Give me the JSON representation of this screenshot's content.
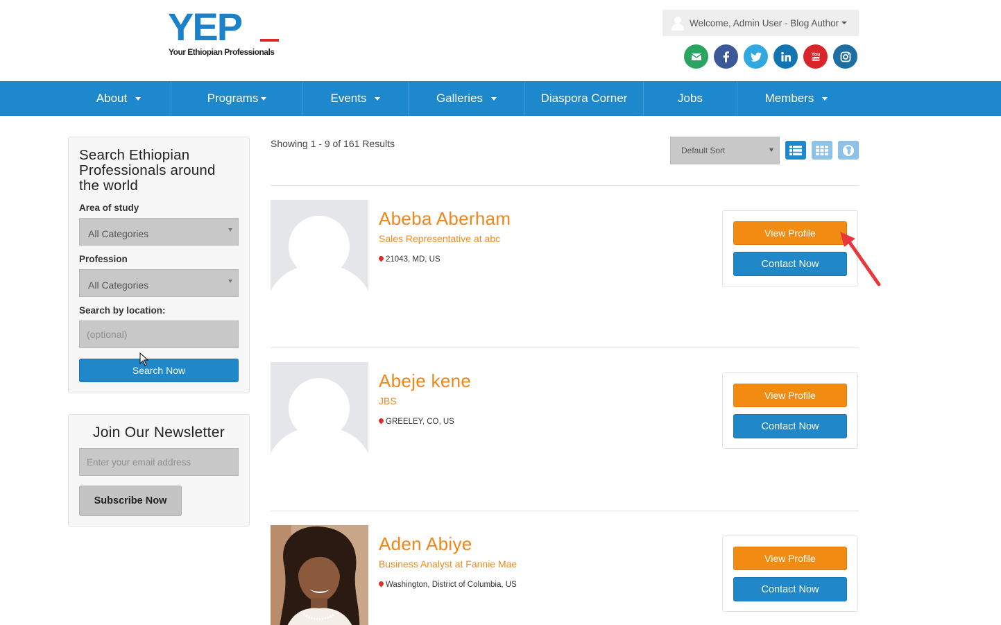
{
  "header": {
    "logo_text": "YEP",
    "logo_tagline": "Your Ethiopian Professionals",
    "welcome_text": "Welcome, Admin User - Blog Author",
    "socials": [
      {
        "name": "email",
        "color": "#2ba462"
      },
      {
        "name": "facebook",
        "color": "#3b5998"
      },
      {
        "name": "twitter",
        "color": "#31a8e0"
      },
      {
        "name": "linkedin",
        "color": "#1275b1"
      },
      {
        "name": "youtube",
        "color": "#d9252a"
      },
      {
        "name": "instagram",
        "color": "#1b6fa3"
      }
    ]
  },
  "nav": {
    "items": [
      {
        "label": "About",
        "has_dropdown": true
      },
      {
        "label": "Programs",
        "has_dropdown": true
      },
      {
        "label": "Events",
        "has_dropdown": true
      },
      {
        "label": "Galleries",
        "has_dropdown": true
      },
      {
        "label": "Diaspora Corner",
        "has_dropdown": false
      },
      {
        "label": "Jobs",
        "has_dropdown": false
      },
      {
        "label": "Members",
        "has_dropdown": true
      }
    ]
  },
  "sidebar": {
    "search": {
      "title": "Search Ethiopian Professionals around the world",
      "area_label": "Area of study",
      "area_value": "All Categories",
      "profession_label": "Profession",
      "profession_value": "All Categories",
      "location_label": "Search by location:",
      "location_placeholder": "(optional)",
      "button_label": "Search Now"
    },
    "newsletter": {
      "title": "Join Our Newsletter",
      "email_placeholder": "Enter your email address",
      "button_label": "Subscribe Now"
    }
  },
  "results": {
    "count_text": "Showing 1 - 9 of 161 Results",
    "sort_value": "Default Sort",
    "view_modes": [
      "list",
      "grid",
      "map"
    ],
    "members": [
      {
        "name": "Abeba Aberham",
        "role": "Sales Representative at abc",
        "location": "21043, MD, US",
        "view_label": "View Profile",
        "contact_label": "Contact Now",
        "has_photo": false
      },
      {
        "name": "Abeje kene",
        "role": "JBS",
        "location": "GREELEY, CO, US",
        "view_label": "View Profile",
        "contact_label": "Contact Now",
        "has_photo": false
      },
      {
        "name": "Aden Abiye",
        "role": "Business Analyst at Fannie Mae",
        "location": "Washington, District of Columbia, US",
        "view_label": "View Profile",
        "contact_label": "Contact Now",
        "has_photo": true
      }
    ]
  },
  "colors": {
    "brand_blue": "#1e88cc",
    "accent_orange": "#f28b12",
    "name_orange": "#f0861a",
    "logo_red": "#e0262b"
  }
}
